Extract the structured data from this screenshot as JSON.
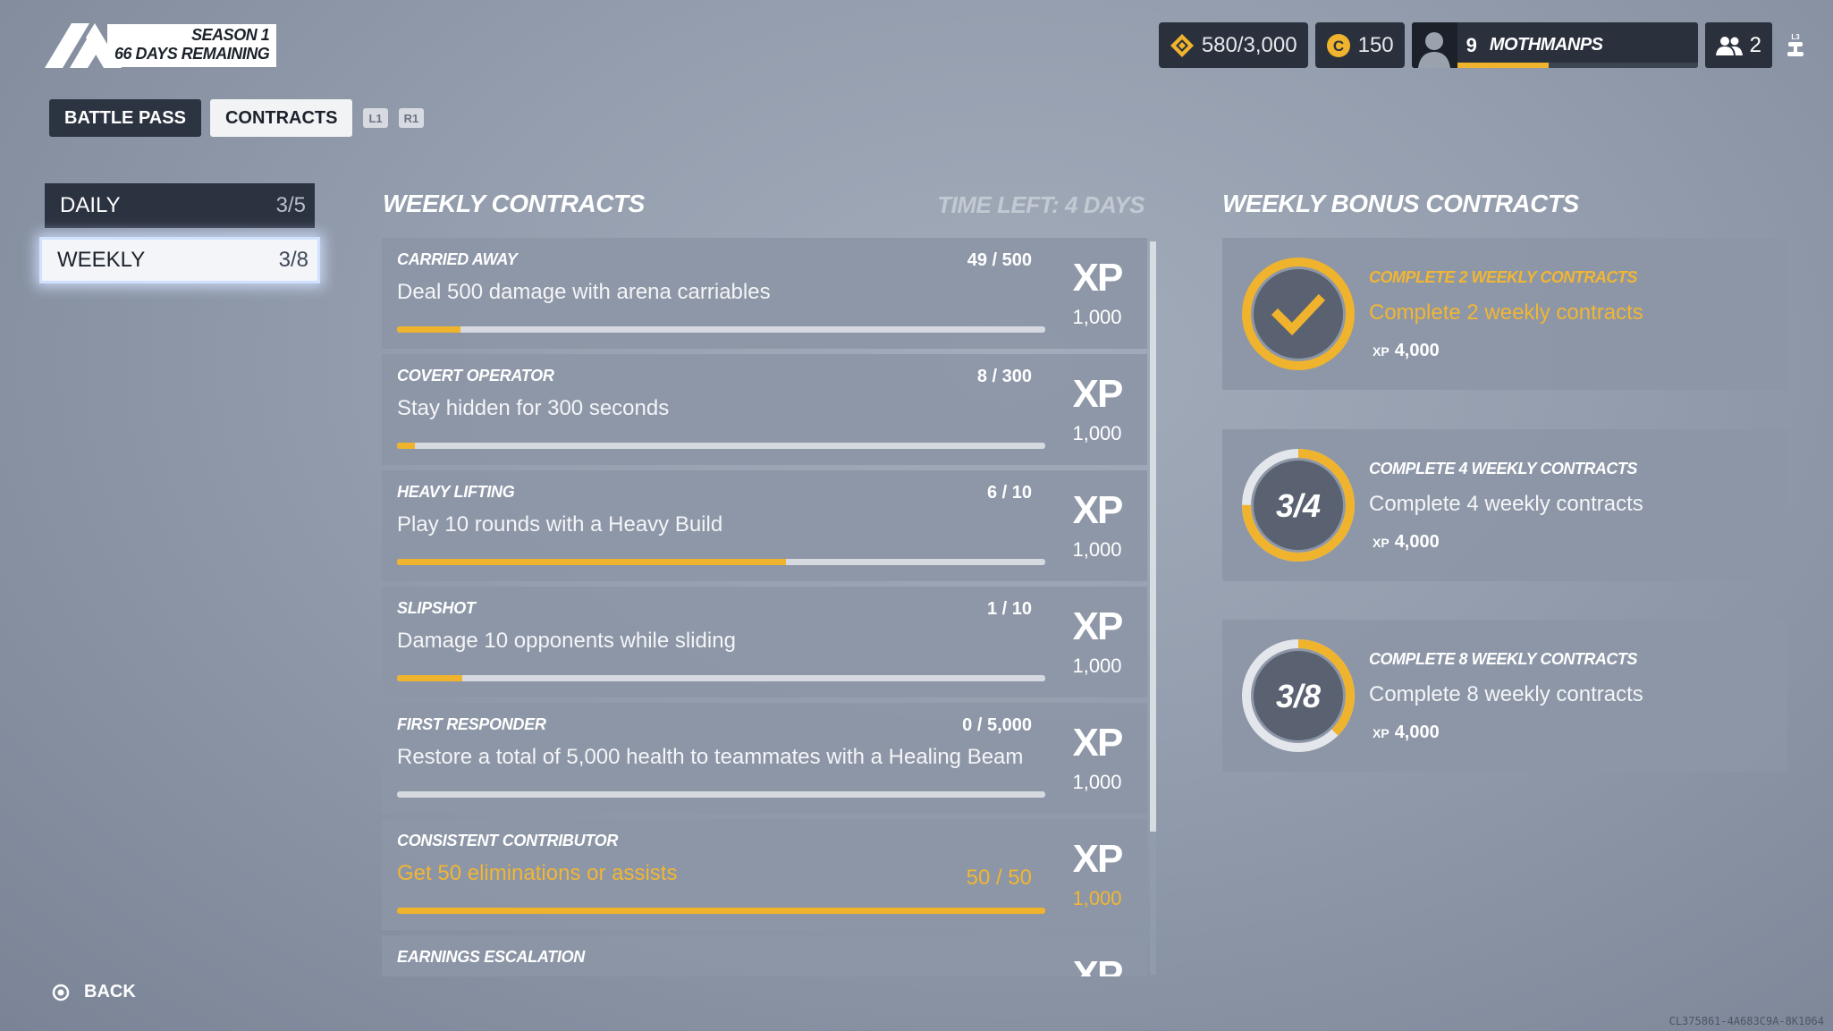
{
  "header": {
    "season_line1": "SEASON 1",
    "season_line2": "66 DAYS REMAINING",
    "tabs": [
      {
        "label": "BATTLE PASS",
        "active": false
      },
      {
        "label": "CONTRACTS",
        "active": true
      }
    ],
    "hint_left": "L1",
    "hint_right": "R1"
  },
  "currencies": {
    "vres": "580/3,000",
    "coins": "150"
  },
  "profile": {
    "level": "9",
    "name": "MOTHMANPS",
    "level_progress": 0.38
  },
  "friends": {
    "count": "2"
  },
  "sidebar": {
    "items": [
      {
        "label": "DAILY",
        "count": "3/5"
      },
      {
        "label": "WEEKLY",
        "count": "3/8"
      }
    ]
  },
  "weekly": {
    "title": "WEEKLY CONTRACTS",
    "time_left": "TIME LEFT: 4 DAYS",
    "xp_label": "XP",
    "contracts": [
      {
        "title": "CARRIED AWAY",
        "desc": "Deal 500 damage with arena carriables",
        "count": "49 / 500",
        "progress": 0.098,
        "xp": "1,000",
        "completed": false
      },
      {
        "title": "COVERT OPERATOR",
        "desc": "Stay hidden for 300 seconds",
        "count": "8 / 300",
        "progress": 0.027,
        "xp": "1,000",
        "completed": false
      },
      {
        "title": "HEAVY LIFTING",
        "desc": "Play 10 rounds with a Heavy Build",
        "count": "6 / 10",
        "progress": 0.6,
        "xp": "1,000",
        "completed": false
      },
      {
        "title": "SLIPSHOT",
        "desc": "Damage 10 opponents while sliding",
        "count": "1 / 10",
        "progress": 0.1,
        "xp": "1,000",
        "completed": false
      },
      {
        "title": "FIRST RESPONDER",
        "desc": "Restore a total of 5,000 health to teammates with a Healing Beam",
        "count": "0 / 5,000",
        "progress": 0,
        "xp": "1,000",
        "completed": false
      },
      {
        "title": "CONSISTENT CONTRIBUTOR",
        "desc": "Get 50 eliminations or assists",
        "count": "50 / 50",
        "progress": 1,
        "xp": "1,000",
        "completed": true
      },
      {
        "title": "EARNINGS ESCALATION",
        "desc": "",
        "count": "",
        "progress": 0,
        "xp": "",
        "completed": false
      }
    ]
  },
  "bonus": {
    "title": "WEEKLY BONUS CONTRACTS",
    "xp_label": "XP",
    "contracts": [
      {
        "title": "COMPLETE 2 WEEKLY CONTRACTS",
        "desc": "Complete 2 weekly contracts",
        "xp": "4,000",
        "ring_label": "",
        "progress": 1,
        "completed": true
      },
      {
        "title": "COMPLETE 4 WEEKLY CONTRACTS",
        "desc": "Complete 4 weekly contracts",
        "xp": "4,000",
        "ring_label": "3/4",
        "progress": 0.75,
        "completed": false
      },
      {
        "title": "COMPLETE 8 WEEKLY CONTRACTS",
        "desc": "Complete 8 weekly contracts",
        "xp": "4,000",
        "ring_label": "3/8",
        "progress": 0.375,
        "completed": false
      }
    ]
  },
  "footer": {
    "back_label": "BACK",
    "build_id": "CL375861-4A683C9A-8K1064"
  },
  "colors": {
    "accent": "#f0b32d",
    "panel_dark": "#2a313d"
  }
}
